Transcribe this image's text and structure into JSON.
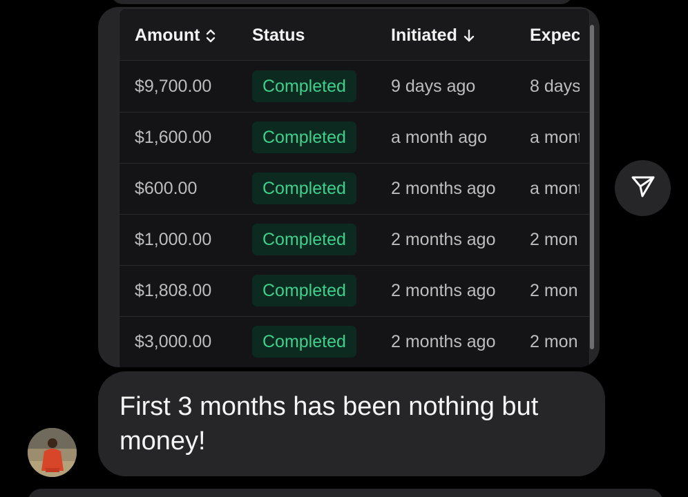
{
  "shared_image": {
    "table": {
      "headers": {
        "amount": "Amount",
        "status": "Status",
        "initiated": "Initiated",
        "expected": "Expec"
      },
      "rows": [
        {
          "amount": "$9,700.00",
          "status": "Completed",
          "initiated": "9 days ago",
          "expected": "8 days"
        },
        {
          "amount": "$1,600.00",
          "status": "Completed",
          "initiated": "a month ago",
          "expected": "a mont"
        },
        {
          "amount": "$600.00",
          "status": "Completed",
          "initiated": "2 months ago",
          "expected": "a mont"
        },
        {
          "amount": "$1,000.00",
          "status": "Completed",
          "initiated": "2 months ago",
          "expected": "2 mon"
        },
        {
          "amount": "$1,808.00",
          "status": "Completed",
          "initiated": "2 months ago",
          "expected": "2 mon"
        },
        {
          "amount": "$3,000.00",
          "status": "Completed",
          "initiated": "2 months ago",
          "expected": "2 mon"
        }
      ]
    }
  },
  "message": {
    "text": "First 3 months has been nothing but money!"
  },
  "icons": {
    "amount_sort": "sort-updown-icon",
    "initiated_sort": "arrow-down-icon",
    "share": "paper-plane-icon"
  },
  "colors": {
    "badge_text": "#3fd08c",
    "badge_bg": "#0c2a20",
    "bubble": "#262628",
    "background": "#000000"
  }
}
